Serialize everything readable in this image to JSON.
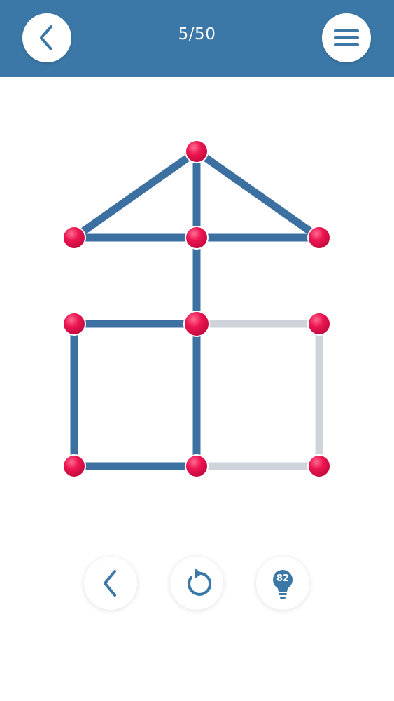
{
  "header": {
    "level": "5/50",
    "back_icon": "chevron-left-icon",
    "menu_icon": "hamburger-menu-icon"
  },
  "colors": {
    "header_bg": "#3b78a8",
    "drawn_line": "#3b70a0",
    "undrawn_line": "#cfd3da",
    "node": "#e8114f"
  },
  "puzzle": {
    "nodes": [
      {
        "id": "n1",
        "gx": 2,
        "gy": 0
      },
      {
        "id": "n2",
        "gx": 0,
        "gy": 1
      },
      {
        "id": "n3",
        "gx": 2,
        "gy": 1
      },
      {
        "id": "n4",
        "gx": 4,
        "gy": 1
      },
      {
        "id": "n5",
        "gx": 0,
        "gy": 2
      },
      {
        "id": "n6",
        "gx": 2,
        "gy": 2,
        "active": true
      },
      {
        "id": "n7",
        "gx": 4,
        "gy": 2
      },
      {
        "id": "n8",
        "gx": 0,
        "gy": 3.65
      },
      {
        "id": "n9",
        "gx": 2,
        "gy": 3.65
      },
      {
        "id": "n10",
        "gx": 4,
        "gy": 3.65
      }
    ],
    "edges": [
      {
        "from": "n2",
        "to": "n1",
        "drawn": true
      },
      {
        "from": "n1",
        "to": "n4",
        "drawn": true
      },
      {
        "from": "n1",
        "to": "n3",
        "drawn": true
      },
      {
        "from": "n2",
        "to": "n3",
        "drawn": true
      },
      {
        "from": "n3",
        "to": "n4",
        "drawn": true
      },
      {
        "from": "n3",
        "to": "n6",
        "drawn": true
      },
      {
        "from": "n5",
        "to": "n6",
        "drawn": true
      },
      {
        "from": "n5",
        "to": "n8",
        "drawn": true
      },
      {
        "from": "n8",
        "to": "n9",
        "drawn": true
      },
      {
        "from": "n6",
        "to": "n9",
        "drawn": true
      },
      {
        "from": "n6",
        "to": "n7",
        "drawn": false
      },
      {
        "from": "n7",
        "to": "n10",
        "drawn": false
      },
      {
        "from": "n9",
        "to": "n10",
        "drawn": false
      }
    ]
  },
  "controls": {
    "undo_icon": "chevron-left-icon",
    "restart_icon": "restart-icon",
    "hint_icon": "lightbulb-icon",
    "hint_count": "82"
  }
}
